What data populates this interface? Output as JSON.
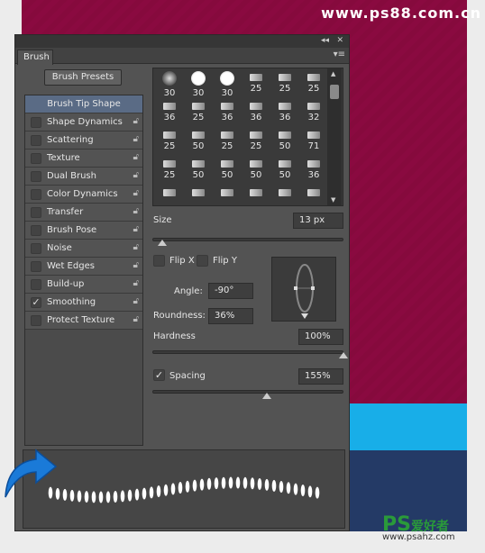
{
  "watermark": "www.ps88.com.cn",
  "panel": {
    "collapse_icon": "double-chevron-left",
    "close_icon": "close",
    "tab": "Brush",
    "menu_icon": "panel-menu",
    "presets_button": "Brush Presets",
    "items": [
      {
        "label": "Brush Tip Shape",
        "selected": true
      },
      {
        "label": "Shape Dynamics",
        "checked": false
      },
      {
        "label": "Scattering",
        "checked": false
      },
      {
        "label": "Texture",
        "checked": false
      },
      {
        "label": "Dual Brush",
        "checked": false
      },
      {
        "label": "Color Dynamics",
        "checked": false
      },
      {
        "label": "Transfer",
        "checked": false
      },
      {
        "label": "Brush Pose",
        "checked": false
      },
      {
        "label": "Noise",
        "checked": false
      },
      {
        "label": "Wet Edges",
        "checked": false
      },
      {
        "label": "Build-up",
        "checked": false
      },
      {
        "label": "Smoothing",
        "checked": true
      },
      {
        "label": "Protect Texture",
        "checked": false
      }
    ],
    "brush_sizes": [
      [
        "30",
        "30",
        "30",
        "25",
        "25",
        "25"
      ],
      [
        "36",
        "25",
        "36",
        "36",
        "36",
        "32"
      ],
      [
        "25",
        "50",
        "25",
        "25",
        "50",
        "71"
      ],
      [
        "25",
        "50",
        "50",
        "50",
        "50",
        "36"
      ]
    ],
    "size_label": "Size",
    "size_value": "13 px",
    "size_slider": 0.05,
    "flip_x": "Flip X",
    "flip_y": "Flip Y",
    "angle_label": "Angle:",
    "angle_value": "-90°",
    "roundness_label": "Roundness:",
    "roundness_value": "36%",
    "hardness_label": "Hardness",
    "hardness_value": "100%",
    "hardness_slider": 1.0,
    "spacing_label": "Spacing",
    "spacing_checked": true,
    "spacing_value": "155%",
    "spacing_slider": 0.6
  },
  "logo": {
    "ps": "PS",
    "cn": "爱好者",
    "url": "www.psahz.com"
  },
  "colors": {
    "canvas": "#8a0a40",
    "band": "#18aee8",
    "navy": "#243a66",
    "panel": "#535353",
    "selected": "#5a6b85"
  }
}
